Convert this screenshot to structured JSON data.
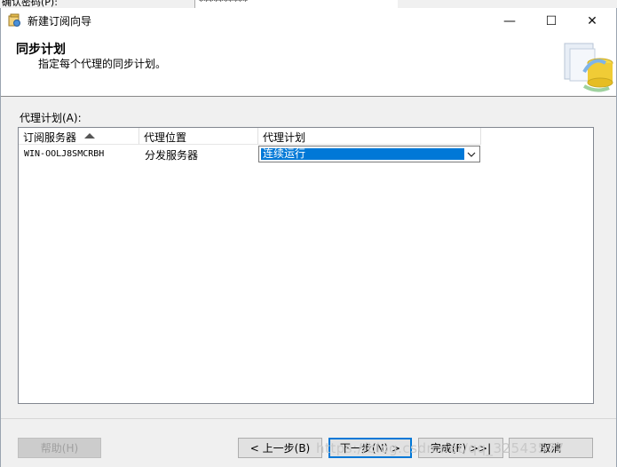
{
  "background_window": {
    "label": "确认密码(P):",
    "field_value": "**********"
  },
  "window": {
    "title": "新建订阅向导",
    "minimize": "—",
    "maximize": "☐",
    "close": "✕"
  },
  "header": {
    "title": "同步计划",
    "subtitle": "指定每个代理的同步计划。"
  },
  "grid": {
    "label": "代理计划(A):",
    "columns": [
      "订阅服务器",
      "代理位置",
      "代理计划"
    ],
    "rows": [
      {
        "subscriber": "WIN-OOLJ8SMCRBH",
        "location": "分发服务器",
        "schedule": "连续运行"
      }
    ]
  },
  "buttons": {
    "help": "帮助(H)",
    "back": "< 上一步(B)",
    "next": "下一步(N) >",
    "finish": "完成(F) >>|",
    "cancel": "取消"
  },
  "watermark": "https://blog.csdn.net/qq_32543577",
  "icons": [
    "app-wizard-icon",
    "minimize-icon",
    "maximize-icon",
    "close-icon",
    "sort-ascending-icon",
    "chevron-down-icon",
    "wizard-database-graphic"
  ]
}
